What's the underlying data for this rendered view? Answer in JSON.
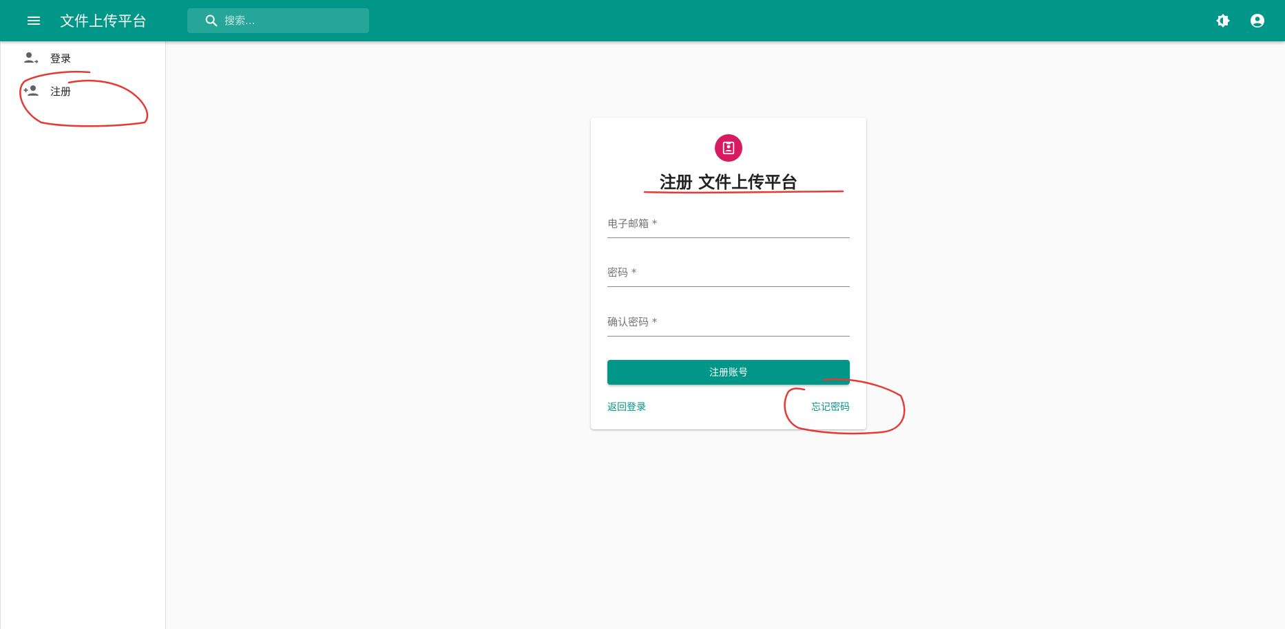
{
  "appbar": {
    "title": "文件上传平台",
    "search_placeholder": "搜索...",
    "icons": {
      "menu": "menu-icon",
      "search": "search-icon",
      "theme": "brightness-icon",
      "account": "account-circle-icon"
    }
  },
  "sidebar": {
    "items": [
      {
        "label": "登录",
        "icon": "login-user-icon"
      },
      {
        "label": "注册",
        "icon": "person-add-icon"
      }
    ]
  },
  "card": {
    "avatar_icon": "badge-icon",
    "title": "注册 文件上传平台",
    "fields": {
      "email": {
        "label": "电子邮箱 *",
        "value": ""
      },
      "password": {
        "label": "密码 *",
        "value": ""
      },
      "confirm": {
        "label": "确认密码 *",
        "value": ""
      }
    },
    "submit_label": "注册账号",
    "back_link": "返回登录",
    "forgot_link": "忘记密码"
  },
  "colors": {
    "primary": "#009688",
    "accent": "#d81b60",
    "annotation": "#e53935"
  }
}
